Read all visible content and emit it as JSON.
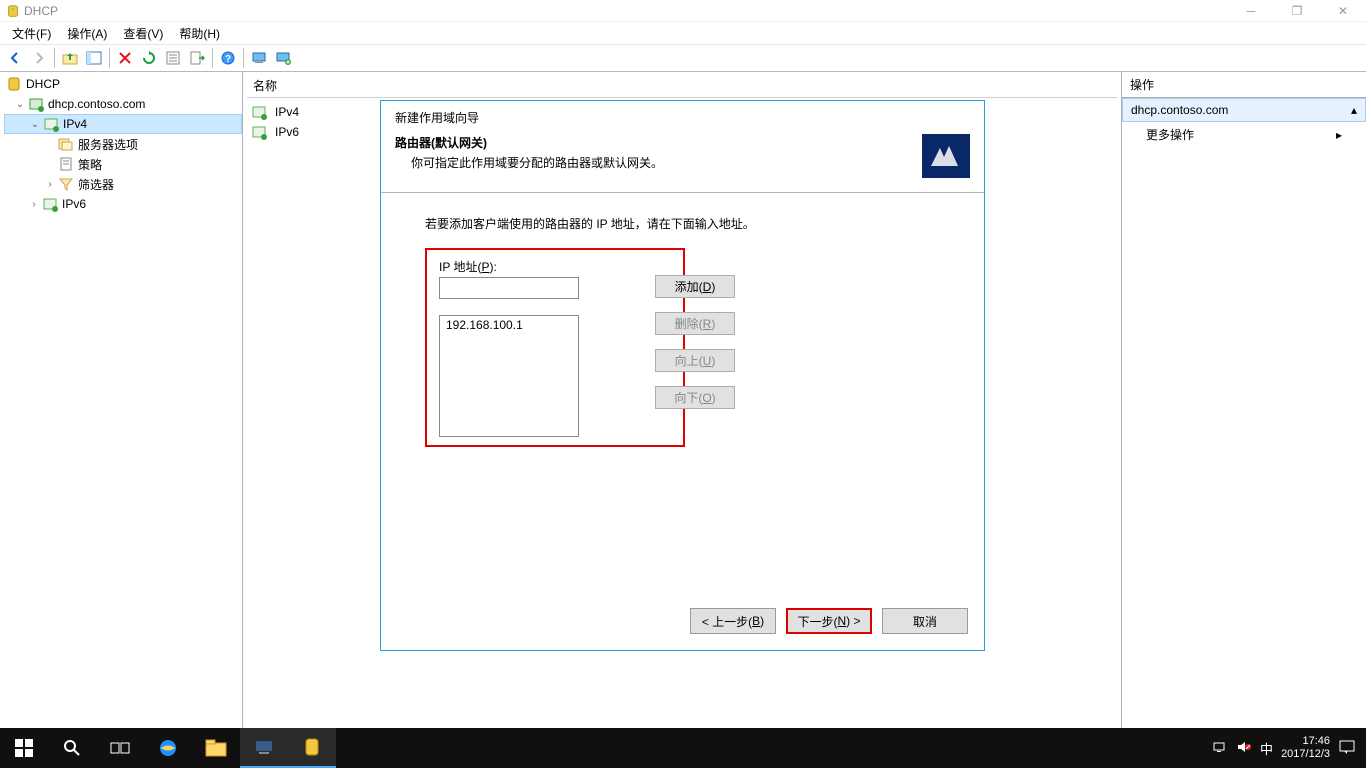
{
  "titlebar": {
    "title": "DHCP"
  },
  "menus": {
    "file": "文件(F)",
    "action": "操作(A)",
    "view": "查看(V)",
    "help": "帮助(H)"
  },
  "tree": {
    "root": "DHCP",
    "server": "dhcp.contoso.com",
    "ipv4": "IPv4",
    "server_options": "服务器选项",
    "policies": "策略",
    "filters": "筛选器",
    "ipv6": "IPv6"
  },
  "center": {
    "column_header": "名称",
    "items": [
      "IPv4",
      "IPv6"
    ]
  },
  "actions": {
    "header": "操作",
    "selected": "dhcp.contoso.com",
    "more": "更多操作"
  },
  "wizard": {
    "caption": "新建作用域向导",
    "title": "路由器(默认网关)",
    "subtitle": "你可指定此作用域要分配的路由器或默认网关。",
    "prompt": "若要添加客户端使用的路由器的 IP 地址，请在下面输入地址。",
    "ip_label": "IP 地址(P):",
    "ip_input_value": "",
    "list_value": "192.168.100.1",
    "btn_add": "添加(D)",
    "btn_remove": "删除(R)",
    "btn_up": "向上(U)",
    "btn_down": "向下(O)",
    "btn_back": "< 上一步(B)",
    "btn_next": "下一步(N) >",
    "btn_cancel": "取消"
  },
  "taskbar": {
    "ime": "中",
    "time": "17:46",
    "date": "2017/12/3"
  }
}
